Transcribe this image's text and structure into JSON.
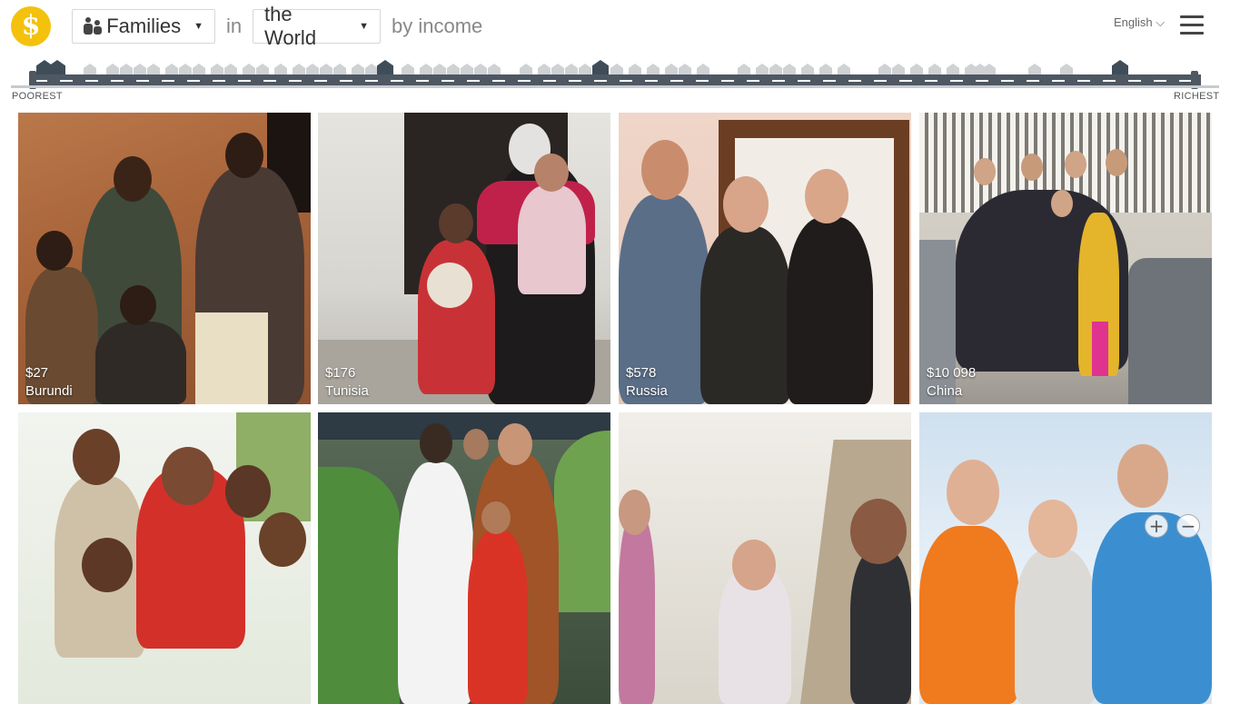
{
  "header": {
    "logo_icon": "dollar-icon",
    "thing_select": {
      "icon": "family-icon",
      "label": "Families"
    },
    "connector_in": "in",
    "place_select": {
      "label": "the World"
    },
    "connector_by": "by income",
    "language": "English ⌵",
    "menu_icon": "hamburger-menu-icon"
  },
  "street": {
    "poorest_label": "POOREST",
    "richest_label": "RICHEST"
  },
  "families": [
    {
      "income": "$27",
      "country": "Burundi"
    },
    {
      "income": "$176",
      "country": "Tunisia"
    },
    {
      "income": "$578",
      "country": "Russia"
    },
    {
      "income": "$10 098",
      "country": "China"
    },
    {
      "income": "",
      "country": ""
    },
    {
      "income": "",
      "country": ""
    },
    {
      "income": "",
      "country": ""
    },
    {
      "income": "",
      "country": ""
    }
  ],
  "zoom": {
    "in_label": "+",
    "out_label": "−"
  },
  "colors": {
    "brand": "#f4c20d",
    "road": "#4e5862"
  }
}
